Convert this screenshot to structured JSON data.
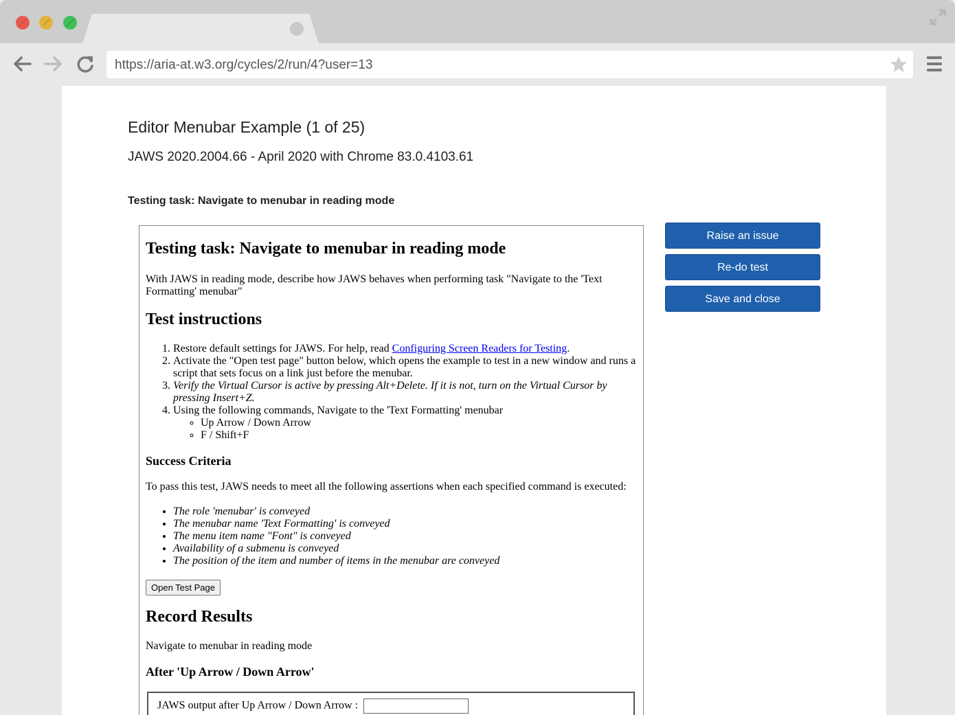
{
  "browser": {
    "url": "https://aria-at.w3.org/cycles/2/run/4?user=13"
  },
  "header": {
    "title": "Editor Menubar Example (1 of 25)",
    "subtitle": "JAWS 2020.2004.66 - April 2020 with Chrome 83.0.4103.61",
    "task_label": "Testing task: Navigate to menubar in reading mode"
  },
  "actions": {
    "raise_issue": "Raise an issue",
    "redo": "Re-do test",
    "save_close": "Save and close"
  },
  "test": {
    "heading": "Testing task: Navigate to menubar in reading mode",
    "intro": "With JAWS in reading mode, describe how JAWS behaves when performing task \"Navigate to the 'Text Formatting' menubar\"",
    "instructions_heading": "Test instructions",
    "step1_text": "Restore default settings for JAWS. For help, read ",
    "step1_link": "Configuring Screen Readers for Testing",
    "step1_end": ".",
    "step2": "Activate the \"Open test page\" button below, which opens the example to test in a new window and runs a script that sets focus on a link just before the menubar.",
    "step3": "Verify the Virtual Cursor is active by pressing Alt+Delete. If it is not, turn on the Virtual Cursor by pressing Insert+Z.",
    "step4": "Using the following commands, Navigate to the 'Text Formatting' menubar",
    "commands": [
      "Up Arrow / Down Arrow",
      "F / Shift+F"
    ],
    "criteria_heading": "Success Criteria",
    "criteria_intro": "To pass this test, JAWS needs to meet all the following assertions when each specified command is executed:",
    "assertions": [
      "The role 'menubar' is conveyed",
      "The menubar name 'Text Formatting' is conveyed",
      "The menu item name \"Font\" is conveyed",
      "Availability of a submenu is conveyed",
      "The position of the item and number of items in the menubar are conveyed"
    ],
    "open_button": "Open Test Page",
    "record_heading": "Record Results",
    "record_text": "Navigate to menubar in reading mode",
    "after_heading": "After 'Up Arrow / Down Arrow'",
    "output_label": "JAWS output after Up Arrow / Down Arrow :",
    "output_value": ""
  },
  "colors": {
    "primary_button": "#1f60ad",
    "link": "#0000ee"
  }
}
